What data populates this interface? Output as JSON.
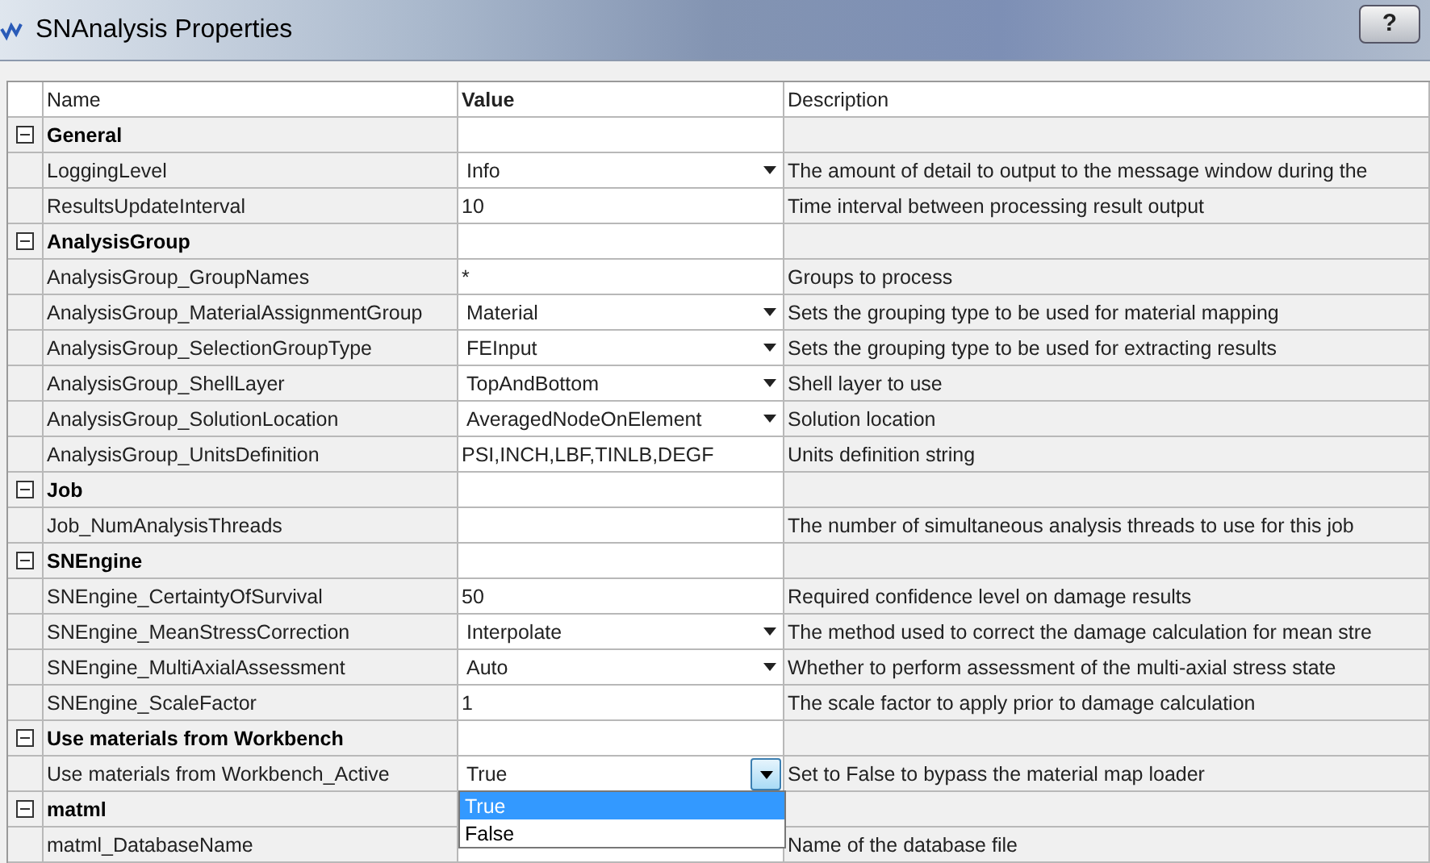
{
  "window": {
    "title": "SNAnalysis Properties",
    "help": "?"
  },
  "columns": [
    "Name",
    "Value",
    "Description"
  ],
  "categories": [
    {
      "name": "General",
      "expanded": true,
      "properties": [
        {
          "name": "LoggingLevel",
          "value": "Info",
          "kind": "dropdown",
          "description": "The amount of detail to output to the message window during the"
        },
        {
          "name": "ResultsUpdateInterval",
          "value": "10",
          "kind": "text",
          "description": "Time interval between processing result output"
        }
      ]
    },
    {
      "name": "AnalysisGroup",
      "expanded": true,
      "properties": [
        {
          "name": "AnalysisGroup_GroupNames",
          "value": "*",
          "kind": "text",
          "description": "Groups to process"
        },
        {
          "name": "AnalysisGroup_MaterialAssignmentGroup",
          "value": "Material",
          "kind": "dropdown",
          "description": "Sets the grouping type to be used for material mapping"
        },
        {
          "name": "AnalysisGroup_SelectionGroupType",
          "value": "FEInput",
          "kind": "dropdown",
          "description": "Sets the grouping type to be used for extracting results"
        },
        {
          "name": "AnalysisGroup_ShellLayer",
          "value": "TopAndBottom",
          "kind": "dropdown",
          "description": "Shell layer to use"
        },
        {
          "name": "AnalysisGroup_SolutionLocation",
          "value": "AveragedNodeOnElement",
          "kind": "dropdown",
          "description": "Solution location"
        },
        {
          "name": "AnalysisGroup_UnitsDefinition",
          "value": "PSI,INCH,LBF,TINLB,DEGF",
          "kind": "text",
          "description": "Units definition string"
        }
      ]
    },
    {
      "name": "Job",
      "expanded": true,
      "properties": [
        {
          "name": "Job_NumAnalysisThreads",
          "kind": "text",
          "description": "The number of simultaneous analysis threads to use for this job"
        }
      ]
    },
    {
      "name": "SNEngine",
      "expanded": true,
      "properties": [
        {
          "name": "SNEngine_CertaintyOfSurvival",
          "value": "50",
          "kind": "text",
          "description": "Required confidence level on damage results"
        },
        {
          "name": "SNEngine_MeanStressCorrection",
          "value": "Interpolate",
          "kind": "dropdown",
          "description": "The method used to correct the damage calculation for mean stre"
        },
        {
          "name": "SNEngine_MultiAxialAssessment",
          "value": "Auto",
          "kind": "dropdown",
          "description": "Whether to perform assessment of the multi-axial stress state"
        },
        {
          "name": "SNEngine_ScaleFactor",
          "value": "1",
          "kind": "text",
          "description": "The scale factor to apply prior to damage calculation"
        }
      ]
    },
    {
      "name": "Use materials from Workbench",
      "expanded": true,
      "properties": [
        {
          "name": "Use materials from Workbench_Active",
          "value": "True",
          "kind": "open-dropdown",
          "description": "Set to False to bypass the material map loader",
          "options": [
            {
              "label": "True",
              "selected": true
            },
            {
              "label": "False",
              "selected": false
            }
          ]
        }
      ]
    },
    {
      "name": "matml",
      "expanded": true,
      "properties": [
        {
          "name": "matml_DatabaseName",
          "kind": "text",
          "description": "Name of the database file"
        }
      ]
    }
  ]
}
